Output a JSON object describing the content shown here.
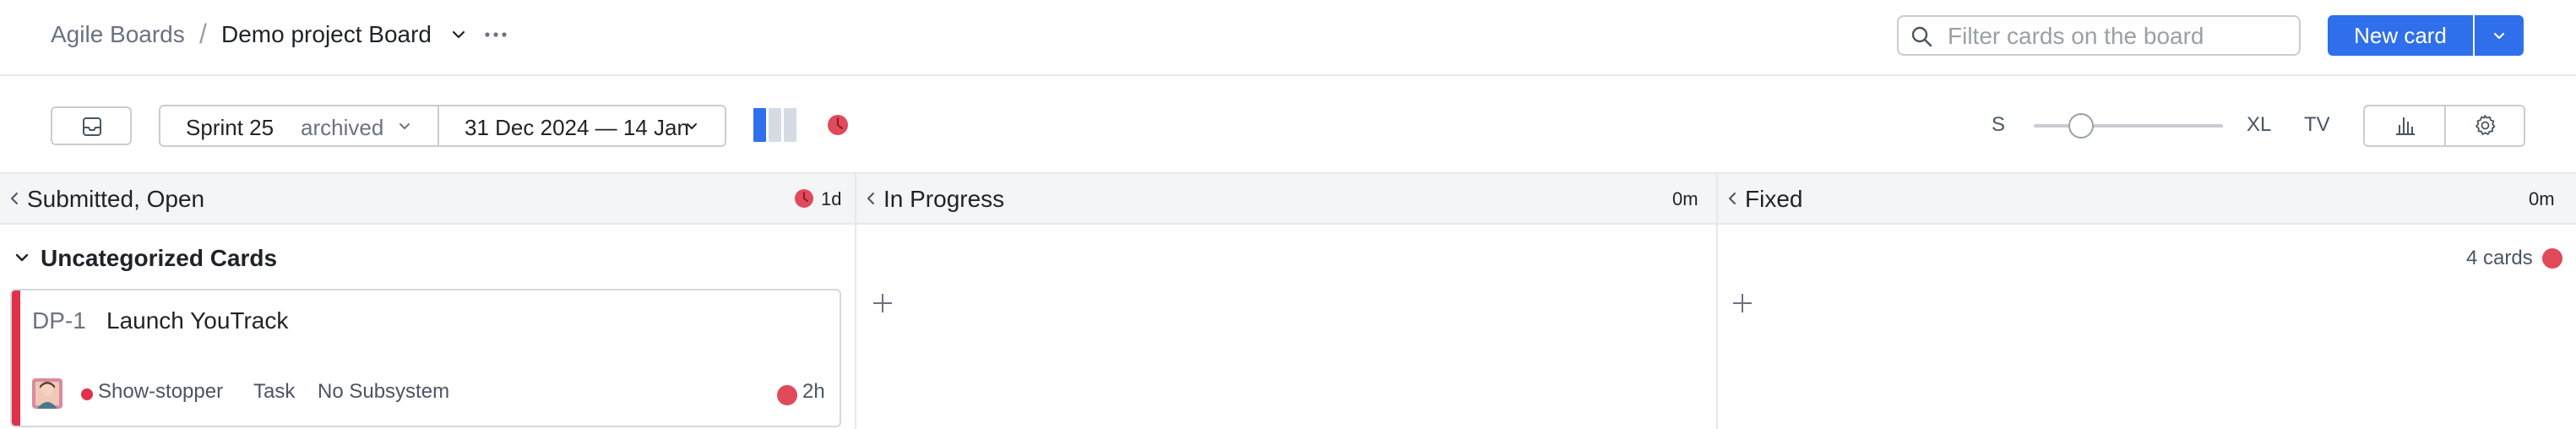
{
  "breadcrumb": {
    "root": "Agile Boards",
    "separator": "/",
    "board": "Demo project Board"
  },
  "header": {
    "search_placeholder": "Filter cards on the board",
    "new_card_label": "New card"
  },
  "toolbar": {
    "sprint_name": "Sprint 25",
    "sprint_status": "archived",
    "date_range": "31 Dec 2024 — 14 Jan",
    "size_small": "S",
    "size_large": "XL",
    "size_tv": "TV",
    "size_level": 0.25
  },
  "columns": [
    {
      "title": "Submitted, Open",
      "time": "1d"
    },
    {
      "title": "In Progress",
      "time": "0m"
    },
    {
      "title": "Fixed",
      "time": "0m"
    }
  ],
  "swimlane": {
    "title": "Uncategorized Cards",
    "count": "4 cards"
  },
  "card": {
    "id": "DP-1",
    "summary": "Launch YouTrack",
    "priority": "Show-stopper",
    "type": "Task",
    "subsystem": "No Subsystem",
    "estimate": "2h"
  },
  "colors": {
    "accent": "#2f6feb",
    "alert": "#e04a5a",
    "stripe": "#e0314b"
  },
  "icons": [
    "chevron-down-icon",
    "more-icon",
    "search-icon",
    "inbox-icon",
    "swimlane-icon",
    "alert-icon",
    "chart-icon",
    "gear-icon",
    "chevron-left-icon",
    "plus-icon"
  ]
}
